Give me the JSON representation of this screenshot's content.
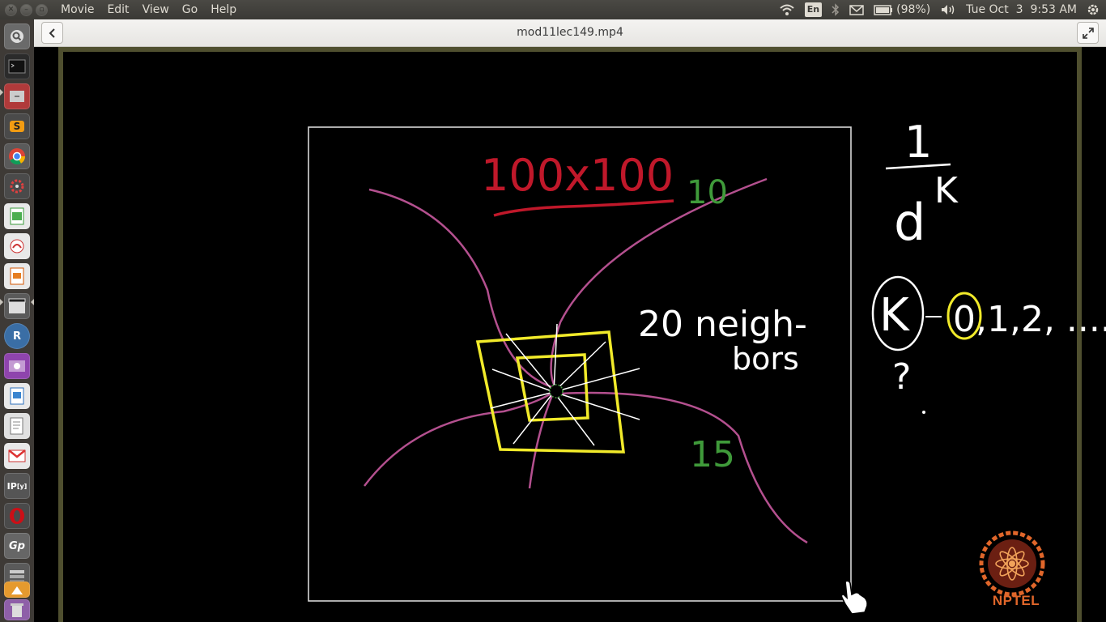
{
  "menubar": {
    "items": [
      "Movie",
      "Edit",
      "View",
      "Go",
      "Help"
    ]
  },
  "tray": {
    "lang": "En",
    "battery": "(98%)",
    "datetime": "Tue Oct  3  9:53 AM",
    "icons": [
      "wifi-icon",
      "bluetooth-icon",
      "mail-icon",
      "battery-icon",
      "volume-icon",
      "settings-gear-icon"
    ]
  },
  "player": {
    "title": "mod11lec149.mp4"
  },
  "launcher": {
    "icons": [
      "dash-icon",
      "terminal-icon",
      "files-icon",
      "sublime-icon",
      "chrome-icon",
      "system-settings-icon",
      "spreadsheet-icon",
      "pdf-viewer-icon",
      "presentation-icon",
      "video-editor-icon",
      "r-studio-icon",
      "screenshot-icon",
      "document-icon",
      "text-editor-icon",
      "gmail-icon",
      "ipython-icon",
      "opera-icon",
      "gp-icon",
      "stack-icon",
      "software-center-icon",
      "trash-icon"
    ]
  },
  "board": {
    "grid_label": "100x100",
    "count_top": "10",
    "count_bottom": "15",
    "neighbors_line1": "20 neigh-",
    "neighbors_line2": "bors",
    "fraction_num": "1",
    "fraction_den": "d",
    "exponent": "K",
    "k_label": "K",
    "k_values": "0,1,2, ....",
    "question": "?"
  },
  "logo": {
    "text": "NPTEL"
  },
  "colors": {
    "red_ink": "#c0182a",
    "green_ink": "#3f9a3a",
    "yellow_ink": "#f1ea2a",
    "pink_ink": "#b4508f",
    "white_ink": "#ffffff",
    "nptel_orange": "#e0662a"
  }
}
